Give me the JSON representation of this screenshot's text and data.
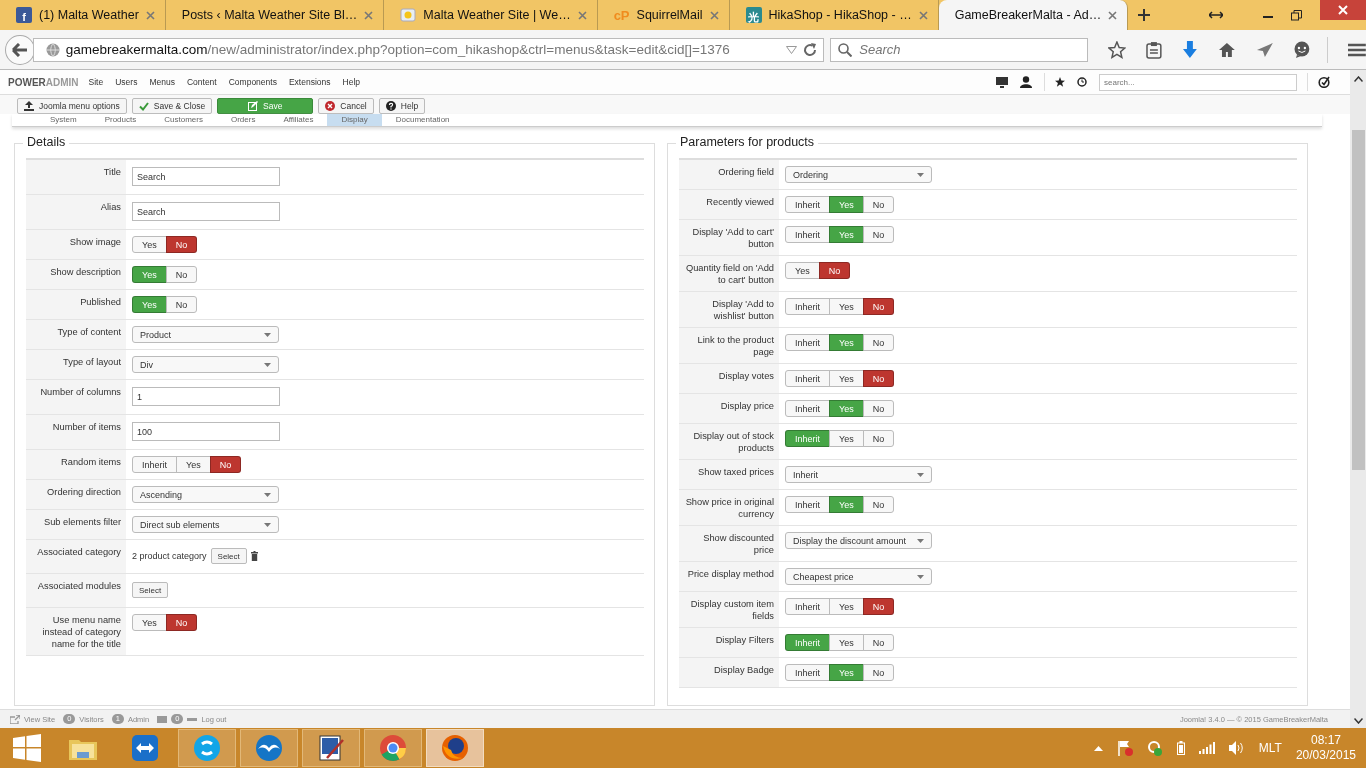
{
  "browser": {
    "tabs": [
      {
        "title": "(1) Malta Weather",
        "kind": "blueletter",
        "icon_text": "f",
        "selected": false
      },
      {
        "title": "Posts ‹ Malta Weather Site Bl…",
        "kind": "blank",
        "selected": false
      },
      {
        "title": "Malta Weather Site | We…",
        "kind": "sun",
        "selected": false
      },
      {
        "title": "SquirrelMail",
        "kind": "orangeletter",
        "icon_text": "cP",
        "selected": false
      },
      {
        "title": "HikaShop - HikaShop - …",
        "kind": "tealletter",
        "icon_text": "光",
        "selected": false
      },
      {
        "title": "GameBreakerMalta - Ad…",
        "kind": "pinwheel",
        "selected": true
      }
    ],
    "url": {
      "domain": "gamebreakermalta.com",
      "path": "/new/administrator/index.php?option=com_hikashop&ctrl=menus&task=edit&cid[]=1376"
    },
    "search_placeholder": "Search"
  },
  "admin": {
    "brand": [
      "POWER",
      "ADMIN"
    ],
    "menu": [
      "Site",
      "Users",
      "Menus",
      "Content",
      "Components",
      "Extensions",
      "Help"
    ],
    "search_placeholder": "search..."
  },
  "toolbar": [
    {
      "label": "Joomla menu options",
      "kind": "options"
    },
    {
      "label": "Save & Close",
      "kind": "save-close"
    },
    {
      "label": "Save",
      "kind": "save"
    },
    {
      "label": "Cancel",
      "kind": "cancel"
    },
    {
      "label": "Help",
      "kind": "help"
    }
  ],
  "subtabs": [
    {
      "label": "System",
      "selected": false
    },
    {
      "label": "Products",
      "selected": false
    },
    {
      "label": "Customers",
      "selected": false
    },
    {
      "label": "Orders",
      "selected": false
    },
    {
      "label": "Affiliates",
      "selected": false
    },
    {
      "label": "Display",
      "selected": true
    },
    {
      "label": "Documentation",
      "selected": false
    }
  ],
  "details": {
    "legend": "Details",
    "rows": [
      {
        "label": "Title",
        "kind": "text",
        "value": "Search"
      },
      {
        "label": "Alias",
        "kind": "text",
        "value": "Search"
      },
      {
        "label": "Show image",
        "kind": "toggle",
        "options": [
          {
            "label": "Yes",
            "selected": false,
            "color": "#f7f7f7"
          },
          {
            "label": "No",
            "selected": true,
            "color": "#bd362f"
          }
        ]
      },
      {
        "label": "Show description",
        "kind": "toggle",
        "options": [
          {
            "label": "Yes",
            "selected": true,
            "color": "#46a546"
          },
          {
            "label": "No",
            "selected": false,
            "color": "#f7f7f7"
          }
        ]
      },
      {
        "label": "Published",
        "kind": "toggle",
        "options": [
          {
            "label": "Yes",
            "selected": true,
            "color": "#46a546"
          },
          {
            "label": "No",
            "selected": false,
            "color": "#f7f7f7"
          }
        ]
      },
      {
        "label": "Type of content",
        "kind": "select",
        "value": "Product"
      },
      {
        "label": "Type of layout",
        "kind": "select",
        "value": "Div"
      },
      {
        "label": "Number of columns",
        "kind": "text",
        "value": "1"
      },
      {
        "label": "Number of items",
        "kind": "text",
        "value": "100"
      },
      {
        "label": "Random items",
        "kind": "toggle",
        "options": [
          {
            "label": "Inherit",
            "selected": false,
            "color": "#f7f7f7"
          },
          {
            "label": "Yes",
            "selected": false,
            "color": "#f7f7f7"
          },
          {
            "label": "No",
            "selected": true,
            "color": "#bd362f"
          }
        ]
      },
      {
        "label": "Ordering direction",
        "kind": "select",
        "value": "Ascending"
      },
      {
        "label": "Sub elements filter",
        "kind": "select",
        "value": "Direct sub elements"
      },
      {
        "label": "Associated category",
        "kind": "category",
        "value": "2 product category",
        "button": "Select"
      },
      {
        "label": "Associated modules",
        "kind": "button",
        "button": "Select"
      },
      {
        "label": "Use menu name instead of category name for the title",
        "kind": "toggle",
        "options": [
          {
            "label": "Yes",
            "selected": false,
            "color": "#f7f7f7"
          },
          {
            "label": "No",
            "selected": true,
            "color": "#bd362f"
          }
        ]
      }
    ]
  },
  "parameters": {
    "legend": "Parameters for products",
    "rows": [
      {
        "label": "Ordering field",
        "kind": "select",
        "value": "Ordering"
      },
      {
        "label": "Recently viewed",
        "kind": "toggle",
        "options": [
          {
            "label": "Inherit",
            "selected": false,
            "color": "#f7f7f7"
          },
          {
            "label": "Yes",
            "selected": true,
            "color": "#46a546"
          },
          {
            "label": "No",
            "selected": false,
            "color": "#f7f7f7"
          }
        ]
      },
      {
        "label": "Display 'Add to cart' button",
        "kind": "toggle",
        "options": [
          {
            "label": "Inherit",
            "selected": false,
            "color": "#f7f7f7"
          },
          {
            "label": "Yes",
            "selected": true,
            "color": "#46a546"
          },
          {
            "label": "No",
            "selected": false,
            "color": "#f7f7f7"
          }
        ]
      },
      {
        "label": "Quantity field on 'Add to cart' button",
        "kind": "toggle",
        "options": [
          {
            "label": "Yes",
            "selected": false,
            "color": "#f7f7f7"
          },
          {
            "label": "No",
            "selected": true,
            "color": "#bd362f"
          }
        ]
      },
      {
        "label": "Display 'Add to wishlist' button",
        "kind": "toggle",
        "options": [
          {
            "label": "Inherit",
            "selected": false,
            "color": "#f7f7f7"
          },
          {
            "label": "Yes",
            "selected": false,
            "color": "#f7f7f7"
          },
          {
            "label": "No",
            "selected": true,
            "color": "#bd362f"
          }
        ]
      },
      {
        "label": "Link to the product page",
        "kind": "toggle",
        "options": [
          {
            "label": "Inherit",
            "selected": false,
            "color": "#f7f7f7"
          },
          {
            "label": "Yes",
            "selected": true,
            "color": "#46a546"
          },
          {
            "label": "No",
            "selected": false,
            "color": "#f7f7f7"
          }
        ]
      },
      {
        "label": "Display votes",
        "kind": "toggle",
        "options": [
          {
            "label": "Inherit",
            "selected": false,
            "color": "#f7f7f7"
          },
          {
            "label": "Yes",
            "selected": false,
            "color": "#f7f7f7"
          },
          {
            "label": "No",
            "selected": true,
            "color": "#bd362f"
          }
        ]
      },
      {
        "label": "Display price",
        "kind": "toggle",
        "options": [
          {
            "label": "Inherit",
            "selected": false,
            "color": "#f7f7f7"
          },
          {
            "label": "Yes",
            "selected": true,
            "color": "#46a546"
          },
          {
            "label": "No",
            "selected": false,
            "color": "#f7f7f7"
          }
        ]
      },
      {
        "label": "Display out of stock products",
        "kind": "toggle",
        "options": [
          {
            "label": "Inherit",
            "selected": true,
            "color": "#46a546"
          },
          {
            "label": "Yes",
            "selected": false,
            "color": "#f7f7f7"
          },
          {
            "label": "No",
            "selected": false,
            "color": "#f7f7f7"
          }
        ]
      },
      {
        "label": "Show taxed prices",
        "kind": "select",
        "value": "Inherit"
      },
      {
        "label": "Show price in original currency",
        "kind": "toggle",
        "options": [
          {
            "label": "Inherit",
            "selected": false,
            "color": "#f7f7f7"
          },
          {
            "label": "Yes",
            "selected": true,
            "color": "#46a546"
          },
          {
            "label": "No",
            "selected": false,
            "color": "#f7f7f7"
          }
        ]
      },
      {
        "label": "Show discounted price",
        "kind": "select",
        "value": "Display the discount amount"
      },
      {
        "label": "Price display method",
        "kind": "select",
        "value": "Cheapest price"
      },
      {
        "label": "Display custom item fields",
        "kind": "toggle",
        "options": [
          {
            "label": "Inherit",
            "selected": false,
            "color": "#f7f7f7"
          },
          {
            "label": "Yes",
            "selected": false,
            "color": "#f7f7f7"
          },
          {
            "label": "No",
            "selected": true,
            "color": "#bd362f"
          }
        ]
      },
      {
        "label": "Display Filters",
        "kind": "toggle",
        "options": [
          {
            "label": "Inherit",
            "selected": true,
            "color": "#46a546"
          },
          {
            "label": "Yes",
            "selected": false,
            "color": "#f7f7f7"
          },
          {
            "label": "No",
            "selected": false,
            "color": "#f7f7f7"
          }
        ]
      },
      {
        "label": "Display Badge",
        "kind": "toggle",
        "options": [
          {
            "label": "Inherit",
            "selected": false,
            "color": "#f7f7f7"
          },
          {
            "label": "Yes",
            "selected": true,
            "color": "#46a546"
          },
          {
            "label": "No",
            "selected": false,
            "color": "#f7f7f7"
          }
        ]
      }
    ]
  },
  "status_bar": {
    "items": [
      {
        "kind": "link",
        "label": "View Site"
      },
      {
        "kind": "count",
        "count": "0",
        "label": "Visitors"
      },
      {
        "kind": "count",
        "count": "1",
        "label": "Admin"
      },
      {
        "kind": "mail",
        "count": "0"
      },
      {
        "kind": "logout",
        "label": "Log out"
      }
    ],
    "copyright": "Joomla! 3.4.0 — © 2015 GameBreakerMalta"
  },
  "taskbar": {
    "apps": [
      {
        "kind": "folder",
        "running": false,
        "active": false
      },
      {
        "kind": "remote",
        "running": false,
        "active": false
      },
      {
        "kind": "chat",
        "running": true,
        "active": false
      },
      {
        "kind": "bird",
        "running": true,
        "active": false
      },
      {
        "kind": "paint",
        "running": true,
        "active": false
      },
      {
        "kind": "chrome",
        "running": true,
        "active": false
      },
      {
        "kind": "firefox",
        "running": true,
        "active": true
      }
    ],
    "language": "MLT",
    "time": "08:17",
    "date": "20/03/2015"
  }
}
